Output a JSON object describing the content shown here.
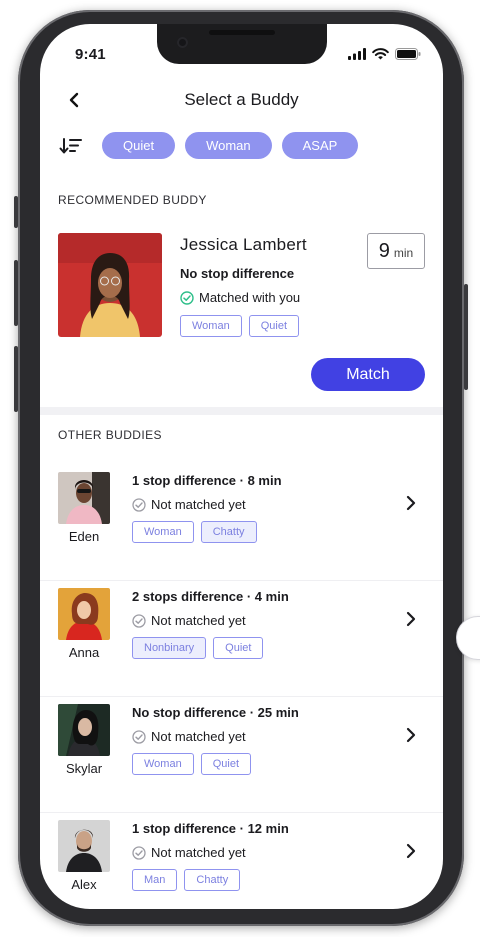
{
  "status_bar": {
    "time": "9:41"
  },
  "header": {
    "title": "Select a Buddy"
  },
  "filters": [
    {
      "label": "Quiet"
    },
    {
      "label": "Woman"
    },
    {
      "label": "ASAP"
    }
  ],
  "recommended": {
    "section_label": "RECOMMENDED BUDDY",
    "name": "Jessica Lambert",
    "stop_difference": "No stop difference",
    "status": "Matched with you",
    "tags": [
      "Woman",
      "Quiet"
    ],
    "time_value": "9",
    "time_unit": "min",
    "match_label": "Match"
  },
  "others": {
    "section_label": "OTHER BUDDIES",
    "items": [
      {
        "name": "Eden",
        "summary": "1 stop difference · 8 min",
        "status": "Not matched yet",
        "tags": [
          "Woman",
          "Chatty"
        ],
        "filled_tag": "Chatty"
      },
      {
        "name": "Anna",
        "summary": "2 stops difference · 4 min",
        "status": "Not matched yet",
        "tags": [
          "Nonbinary",
          "Quiet"
        ],
        "filled_tag": "Nonbinary"
      },
      {
        "name": "Skylar",
        "summary": "No stop difference · 25 min",
        "status": "Not matched yet",
        "tags": [
          "Woman",
          "Quiet"
        ],
        "filled_tag": ""
      },
      {
        "name": "Alex",
        "summary": "1 stop difference · 12 min",
        "status": "Not matched yet",
        "tags": [
          "Man",
          "Chatty"
        ],
        "filled_tag": ""
      }
    ]
  },
  "colors": {
    "chip": "#8f93ef",
    "primary": "#4141e3",
    "success": "#2fbf8a",
    "muted": "#9c9ca4"
  }
}
